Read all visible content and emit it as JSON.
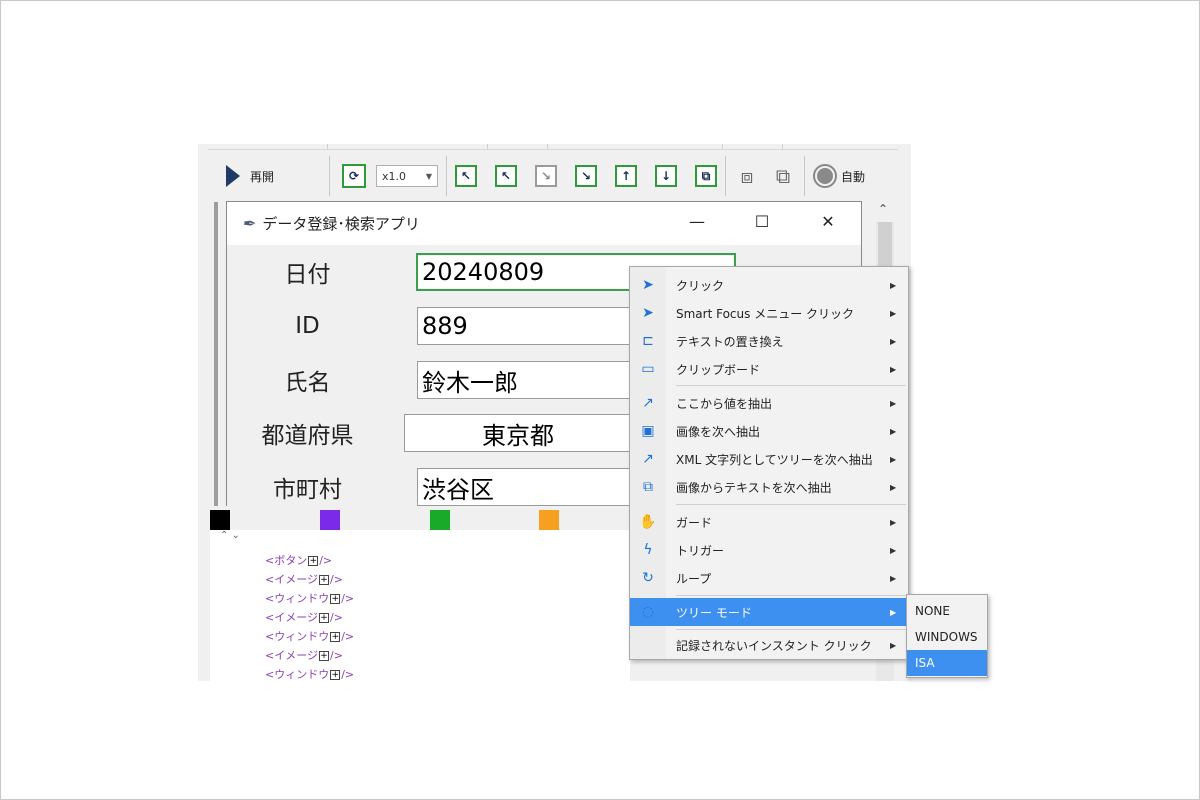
{
  "toolbar": {
    "play_label": "再開",
    "speed_value": "x1.0",
    "record_label": "自動"
  },
  "app": {
    "title": "データ登録･検索アプリ",
    "minimize": "—",
    "maximize": "☐",
    "close": "✕",
    "fields": [
      {
        "label": "日付",
        "value": "20240809"
      },
      {
        "label": "ID",
        "value": "889"
      },
      {
        "label": "氏名",
        "value": "鈴木一郎"
      },
      {
        "label": "都道府県",
        "value": "東京都"
      },
      {
        "label": "市町村",
        "value": "渋谷区"
      }
    ]
  },
  "palette": {
    "colors": [
      "#000000",
      "#7a2ae8",
      "#1aaa2a",
      "#f5a020"
    ]
  },
  "tree": {
    "nodes": [
      {
        "tag": "<ボタン",
        "close": "/>"
      },
      {
        "tag": "<イメージ",
        "close": "/>"
      },
      {
        "tag": "<ウィンドウ",
        "close": "/>"
      },
      {
        "tag": "<イメージ",
        "close": "/>"
      },
      {
        "tag": "<ウィンドウ",
        "close": "/>"
      },
      {
        "tag": "<イメージ",
        "close": "/>"
      },
      {
        "tag": "<ウィンドウ",
        "close": "/>"
      }
    ]
  },
  "context_menu": {
    "items": [
      {
        "label": "クリック",
        "icon": "cursor-icon"
      },
      {
        "label": "Smart Focus メニュー クリック",
        "icon": "cursor-icon"
      },
      {
        "label": "テキストの置き換え",
        "icon": "text-field-icon"
      },
      {
        "label": "クリップボード",
        "icon": "clipboard-icon"
      },
      {
        "label": "ここから値を抽出",
        "icon": "extract-arrow-icon"
      },
      {
        "label": "画像を次へ抽出",
        "icon": "image-icon"
      },
      {
        "label": "XML 文字列としてツリーを次へ抽出",
        "icon": "extract-arrow-icon"
      },
      {
        "label": "画像からテキストを次へ抽出",
        "icon": "ocr-icon"
      },
      {
        "label": "ガード",
        "icon": "hand-icon"
      },
      {
        "label": "トリガー",
        "icon": "lightning-icon"
      },
      {
        "label": "ループ",
        "icon": "loop-icon"
      },
      {
        "label": "ツリー モード",
        "icon": "tree-icon"
      },
      {
        "label": "記録されないインスタント クリック",
        "icon": ""
      }
    ]
  },
  "submenu": {
    "items": [
      "NONE",
      "WINDOWS",
      "ISA"
    ]
  }
}
